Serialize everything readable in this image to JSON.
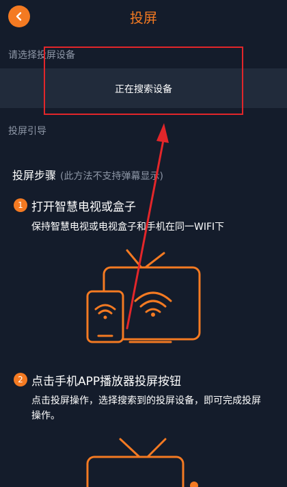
{
  "header": {
    "title": "投屏",
    "back_icon": "chevron-left-icon"
  },
  "device_section": {
    "label": "请选择投屏设备",
    "status_text": "正在搜索设备"
  },
  "guide_section": {
    "label": "投屏引导"
  },
  "steps": {
    "heading": "投屏步骤",
    "note": "(此方法不支持弹幕显示)",
    "items": [
      {
        "number": "1",
        "title": "打开智慧电视或盒子",
        "description": "保持智慧电视或电视盒子和手机在同一WIFI下"
      },
      {
        "number": "2",
        "title": "点击手机APP播放器投屏按钮",
        "description": "点击投屏操作，选择搜索到的投屏设备，即可完成投屏操作。"
      }
    ]
  },
  "colors": {
    "accent": "#f47a22",
    "background": "#141c2b",
    "panel": "#212b3b",
    "highlight": "#e3262a"
  }
}
